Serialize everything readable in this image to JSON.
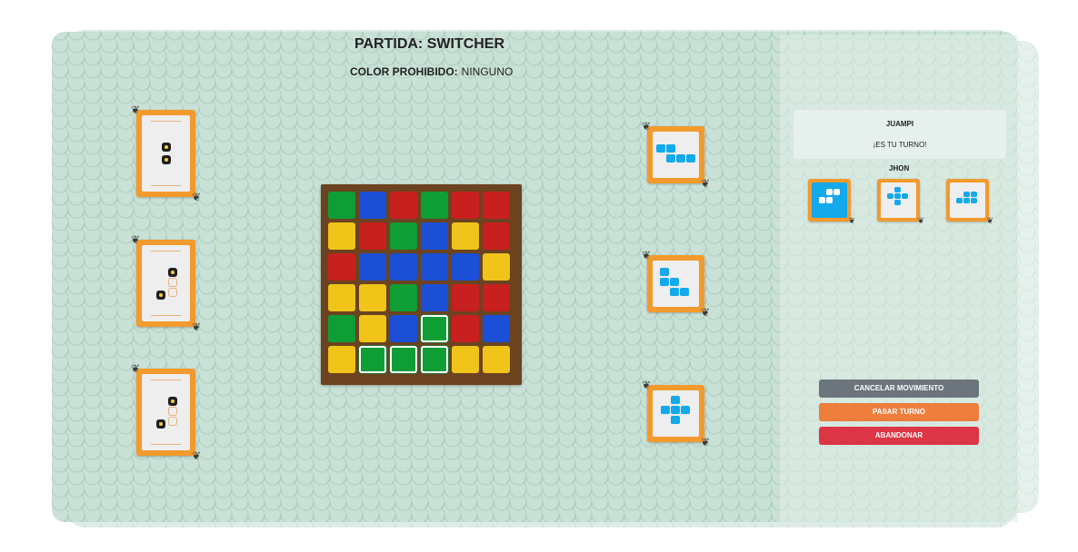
{
  "header": {
    "title": "PARTIDA: SWITCHER",
    "forbidden_label": "COLOR PROHIBIDO:",
    "forbidden_value": "NINGUNO"
  },
  "colors": {
    "green": "#0f9d36",
    "blue": "#1a4fd6",
    "red": "#c81f1f",
    "yellow": "#f0c419",
    "card_orange": "#f29a2e",
    "figure_blue": "#13a9ea",
    "board_brown": "#6b4320"
  },
  "board": {
    "rows": [
      [
        "green",
        "blue",
        "red",
        "green",
        "red",
        "red"
      ],
      [
        "yellow",
        "red",
        "green",
        "blue",
        "yellow",
        "red"
      ],
      [
        "red",
        "blue",
        "blue",
        "blue",
        "blue",
        "yellow"
      ],
      [
        "yellow",
        "yellow",
        "green",
        "blue",
        "red",
        "red"
      ],
      [
        "green",
        "yellow",
        "blue",
        "green",
        "red",
        "blue"
      ],
      [
        "yellow",
        "green",
        "green",
        "green",
        "yellow",
        "yellow"
      ]
    ],
    "highlighted": [
      [
        4,
        3
      ],
      [
        5,
        1
      ],
      [
        5,
        2
      ],
      [
        5,
        3
      ]
    ]
  },
  "movement_cards": [
    {
      "icon": "movement-card-icon"
    },
    {
      "icon": "movement-card-icon"
    },
    {
      "icon": "movement-card-icon"
    }
  ],
  "figure_cards": [
    {
      "icon": "figure-card-icon"
    },
    {
      "icon": "figure-card-icon"
    },
    {
      "icon": "figure-card-icon"
    }
  ],
  "turn_panel": {
    "current_player": "JUAMPI",
    "turn_message": "¡ES TU TURNO!",
    "other_player": "JHON"
  },
  "buttons": {
    "cancel": {
      "label": "CANCELAR MOVIMIENTO",
      "color": "#6c757d"
    },
    "pass": {
      "label": "PASAR TURNO",
      "color": "#ef7d3c"
    },
    "abandon": {
      "label": "ABANDONAR",
      "color": "#dc3545"
    }
  }
}
